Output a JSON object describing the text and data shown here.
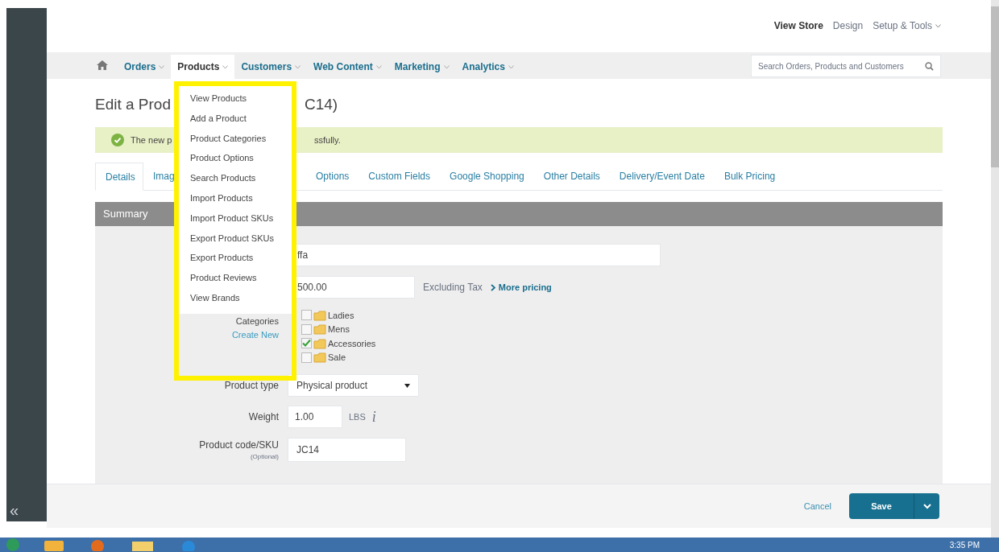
{
  "top_links": [
    {
      "label": "View Store",
      "emphasized": true
    },
    {
      "label": "Design",
      "emphasized": false
    },
    {
      "label": "Setup & Tools",
      "emphasized": false,
      "caret": true
    }
  ],
  "nav": {
    "items": [
      {
        "label": "Orders",
        "selected": false
      },
      {
        "label": "Products",
        "selected": true
      },
      {
        "label": "Customers",
        "selected": false
      },
      {
        "label": "Web Content",
        "selected": false
      },
      {
        "label": "Marketing",
        "selected": false
      },
      {
        "label": "Analytics",
        "selected": false
      }
    ],
    "search_placeholder": "Search Orders, Products and Customers"
  },
  "dropdown": {
    "items": [
      "View Products",
      "Add a Product",
      "Product Categories",
      "Product Options",
      "Search Products",
      "Import Products",
      "Import Product SKUs",
      "Export Product SKUs",
      "Export Products",
      "Product Reviews",
      "View Brands"
    ]
  },
  "page_title": {
    "left": "Edit a Prod",
    "right": "C14)"
  },
  "banner": {
    "left": "The new p",
    "right": "ssfully."
  },
  "tabs": [
    {
      "label": "Details",
      "selected": true
    },
    {
      "label": "Imag",
      "selected": false
    },
    {
      "label": "Options",
      "selected": false
    },
    {
      "label": "Custom Fields",
      "selected": false
    },
    {
      "label": "Google Shopping",
      "selected": false
    },
    {
      "label": "Other Details",
      "selected": false
    },
    {
      "label": "Delivery/Event Date",
      "selected": false
    },
    {
      "label": "Bulk Pricing",
      "selected": false
    }
  ],
  "section_title": "Summary",
  "form": {
    "name_value": "ffa",
    "price_value": "500.00",
    "price_note": "Excluding Tax",
    "more_pricing": "More pricing",
    "categories_label": "Categories",
    "create_new": "Create New",
    "categories": [
      {
        "label": "Ladies",
        "checked": false
      },
      {
        "label": "Mens",
        "checked": false
      },
      {
        "label": "Accessories",
        "checked": true
      },
      {
        "label": "Sale",
        "checked": false
      }
    ],
    "product_type_label": "Product type",
    "product_type_value": "Physical product",
    "weight_label": "Weight",
    "weight_value": "1.00",
    "weight_unit": "LBS",
    "info_glyph": "i",
    "sku_label": "Product code/SKU",
    "sku_hint": "(Optional)",
    "sku_value": "JC14"
  },
  "footer": {
    "cancel": "Cancel",
    "save": "Save"
  },
  "sidebar": {
    "collapse_glyph": "«"
  },
  "taskbar": {
    "clock": "3:35 PM"
  }
}
